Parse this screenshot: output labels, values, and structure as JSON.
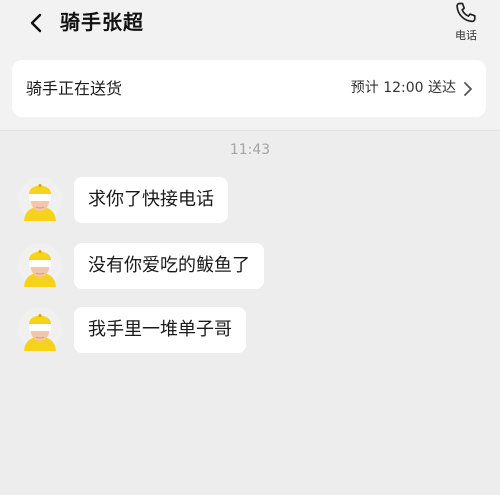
{
  "header": {
    "rider_name": "骑手张超",
    "call_label": "电话",
    "back_icon": "chevron-left-icon",
    "call_icon": "phone-icon"
  },
  "status": {
    "text": "骑手正在送货",
    "eta": "预计 12:00 送达",
    "chevron_icon": "chevron-right-icon"
  },
  "chat": {
    "timestamp": "11:43",
    "messages": [
      {
        "text": "求你了快接电话"
      },
      {
        "text": "没有你爱吃的鲅鱼了"
      },
      {
        "text": "我手里一堆单子哥"
      }
    ]
  },
  "colors": {
    "background": "#ededed",
    "bubble": "#ffffff",
    "avatar_yellow": "#f6d21a",
    "timestamp": "#a5a5a5"
  }
}
